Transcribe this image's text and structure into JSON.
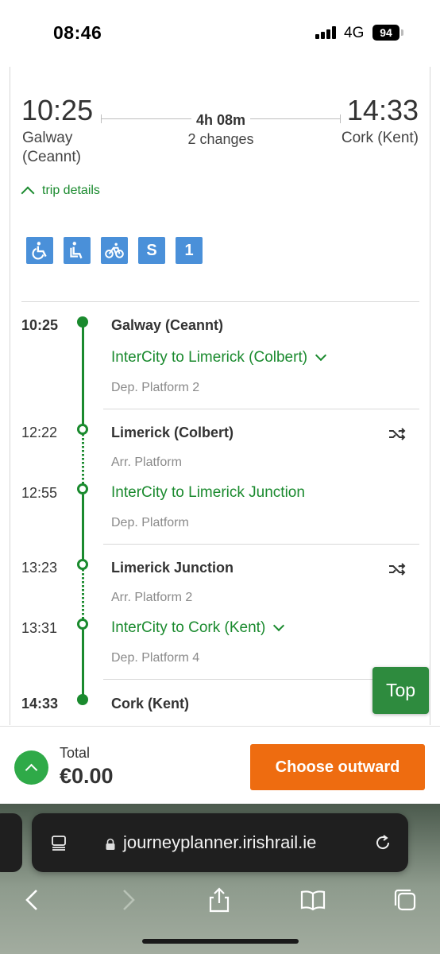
{
  "status_bar": {
    "time": "08:46",
    "network": "4G",
    "battery": "94"
  },
  "journey": {
    "departure_time": "10:25",
    "departure_station": "Galway (Ceannt)",
    "arrival_time": "14:33",
    "arrival_station": "Cork (Kent)",
    "duration": "4h 08m",
    "changes": "2 changes",
    "trip_details_label": "trip details"
  },
  "facilities": [
    {
      "icon": "wheelchair-icon"
    },
    {
      "icon": "seat-reservation-icon"
    },
    {
      "icon": "bicycle-icon"
    },
    {
      "label": "S"
    },
    {
      "label": "1"
    }
  ],
  "stops": {
    "galway": {
      "time": "10:25",
      "name": "Galway (Ceannt)",
      "service": "InterCity to Limerick (Colbert)",
      "platform": "Dep. Platform 2"
    },
    "limerick_colbert": {
      "arr_time": "12:22",
      "name": "Limerick (Colbert)",
      "arr_platform": "Arr. Platform",
      "dep_time": "12:55",
      "service": "InterCity to Limerick Junction",
      "dep_platform": "Dep. Platform"
    },
    "limerick_junction": {
      "arr_time": "13:23",
      "name": "Limerick Junction",
      "arr_platform": "Arr. Platform 2",
      "dep_time": "13:31",
      "service": "InterCity to Cork (Kent)",
      "dep_platform": "Dep. Platform 4"
    },
    "cork": {
      "time": "14:33",
      "name": "Cork (Kent)"
    }
  },
  "top_button": "Top",
  "footer": {
    "total_label": "Total",
    "total_price": "€0.00",
    "choose_label": "Choose outward"
  },
  "browser": {
    "url": "journeyplanner.irishrail.ie"
  },
  "colors": {
    "green": "#1a8a2e",
    "orange": "#ee6c10",
    "facility_blue": "#4a90d9"
  }
}
